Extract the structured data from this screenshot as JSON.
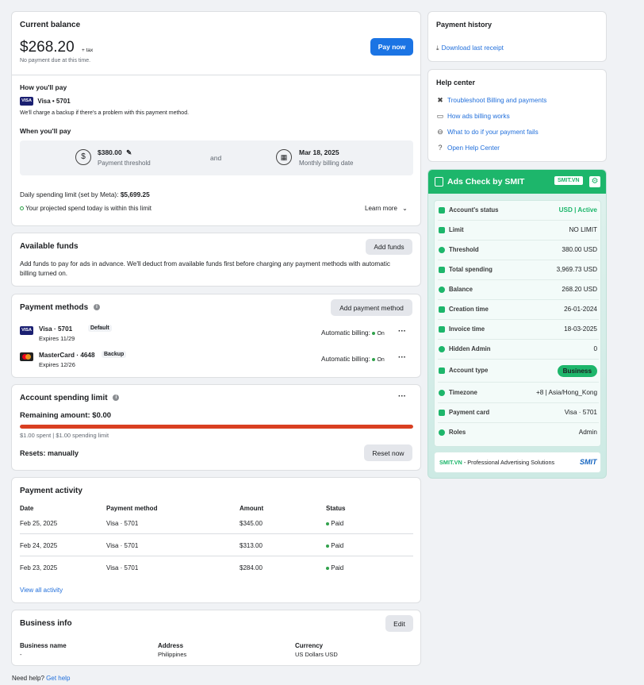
{
  "balance": {
    "title": "Current balance",
    "amount": "$268.20",
    "tax": "+ tax",
    "note": "No payment due at this time.",
    "pay_button": "Pay now",
    "how_title": "How you'll pay",
    "card_label": "Visa • 5701",
    "backup_note": "We'll charge a backup if there's a problem with this payment method.",
    "when_title": "When you'll pay",
    "threshold_amount": "$380.00",
    "threshold_label": "Payment threshold",
    "and": "and",
    "billing_date": "Mar 18, 2025",
    "billing_date_label": "Monthly billing date",
    "daily_limit_label": "Daily spending limit (set by Meta): ",
    "daily_limit_value": "$5,699.25",
    "projected_note": "Your projected spend today is within this limit",
    "learn_more": "Learn more"
  },
  "funds": {
    "title": "Available funds",
    "button": "Add funds",
    "desc": "Add funds to pay for ads in advance. We'll deduct from available funds first before charging any payment methods with automatic billing turned on."
  },
  "methods": {
    "title": "Payment methods",
    "button": "Add payment method",
    "items": [
      {
        "name": "Visa · 5701",
        "badge": "Default",
        "expires": "Expires 11/29",
        "billing": "Automatic billing: ",
        "status": "On"
      },
      {
        "name": "MasterCard · 4648",
        "badge": "Backup",
        "expires": "Expires 12/26",
        "billing": "Automatic billing: ",
        "status": "On"
      }
    ]
  },
  "spending_limit": {
    "title": "Account spending limit",
    "remaining": "Remaining amount: $0.00",
    "spent_note": "$1.00 spent | $1.00 spending limit",
    "resets": "Resets: manually",
    "reset_button": "Reset now",
    "progress_fraction": 1.0,
    "progress_color": "#d93f21"
  },
  "activity": {
    "title": "Payment activity",
    "headers": [
      "Date",
      "Payment method",
      "Amount",
      "Status"
    ],
    "rows": [
      {
        "date": "Feb 25, 2025",
        "method": "Visa · 5701",
        "amount": "$345.00",
        "status": "Paid"
      },
      {
        "date": "Feb 24, 2025",
        "method": "Visa · 5701",
        "amount": "$313.00",
        "status": "Paid"
      },
      {
        "date": "Feb 23, 2025",
        "method": "Visa · 5701",
        "amount": "$284.00",
        "status": "Paid"
      }
    ],
    "view_all": "View all activity"
  },
  "business": {
    "title": "Business info",
    "edit": "Edit",
    "name_label": "Business name",
    "name_value": "-",
    "address_label": "Address",
    "address_value": "Philippines",
    "currency_label": "Currency",
    "currency_value": "US Dollars USD"
  },
  "footer": {
    "need_help": "Need help?",
    "get_help": "Get help"
  },
  "history": {
    "title": "Payment history",
    "download": "Download last receipt"
  },
  "help": {
    "title": "Help center",
    "items": [
      {
        "label": "Troubleshoot Billing and payments",
        "icon": "tools-icon"
      },
      {
        "label": "How ads billing works",
        "icon": "card-icon"
      },
      {
        "label": "What to do if your payment fails",
        "icon": "minus-circle-icon"
      },
      {
        "label": "Open Help Center",
        "icon": "question-icon"
      }
    ]
  },
  "smit": {
    "title": "Ads Check by SMIT",
    "badge": "SMIT.VN",
    "accent": "#1db66b",
    "rows": [
      {
        "label": "Account's status",
        "value": "USD | Active"
      },
      {
        "label": "Limit",
        "value": "NO LIMIT"
      },
      {
        "label": "Threshold",
        "value": "380.00 USD"
      },
      {
        "label": "Total spending",
        "value": "3,969.73 USD"
      },
      {
        "label": "Balance",
        "value": "268.20 USD"
      },
      {
        "label": "Creation time",
        "value": "26-01-2024"
      },
      {
        "label": "Invoice time",
        "value": "18-03-2025"
      },
      {
        "label": "Hidden Admin",
        "value": "0"
      },
      {
        "label": "Account type",
        "value": "Business"
      },
      {
        "label": "Timezone",
        "value": "+8 | Asia/Hong_Kong"
      },
      {
        "label": "Payment card",
        "value": "Visa · 5701"
      },
      {
        "label": "Roles",
        "value": "Admin"
      }
    ],
    "footer_brand": "SMIT.VN",
    "footer_text": " - Professional Advertising Solutions",
    "footer_logo": "SMIT"
  }
}
